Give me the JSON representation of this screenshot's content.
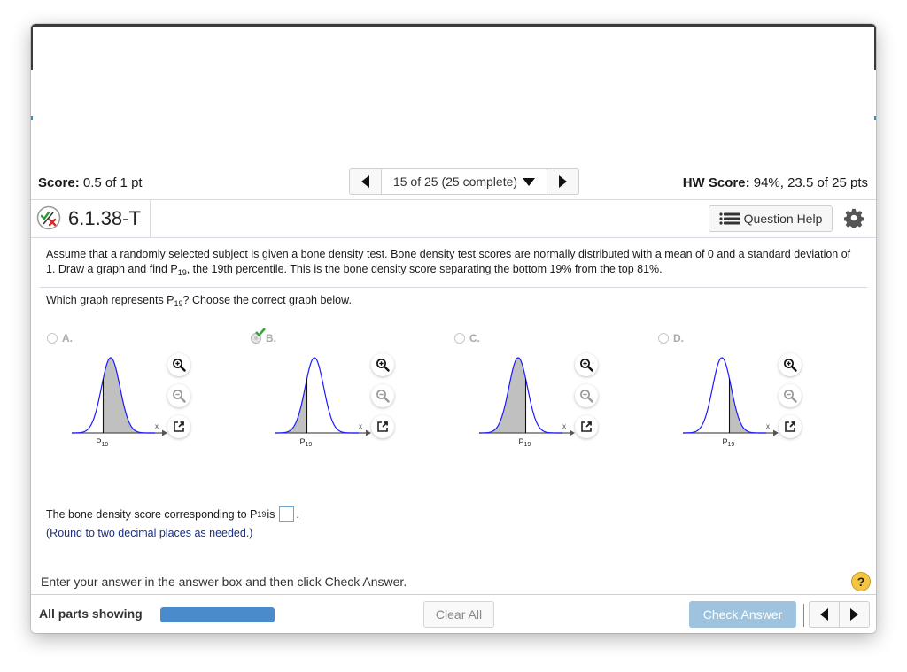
{
  "header": {
    "score_label": "Score:",
    "score_value": "0.5 of 1 pt",
    "hw_score_label": "HW Score:",
    "hw_score_value": "94%, 23.5 of 25 pts",
    "question_nav": {
      "label": "15 of 25 (25 complete)",
      "current": 15,
      "total": 25,
      "complete": 25
    }
  },
  "question": {
    "status_icon": "partial-credit-icon",
    "id": "6.1.38-T",
    "help_label": "Question Help",
    "prompt_part1": "Assume that a randomly selected subject is given a bone density test. Bone density test scores are normally distributed with a mean of 0 and a standard deviation of 1. Draw a graph and find P",
    "prompt_sub": "19",
    "prompt_part2": ", the 19th percentile. This is the bone density score separating the bottom 19% from the top 81%.",
    "which_part1": "Which graph represents P",
    "which_sub": "19",
    "which_part2": "? Choose the correct graph below.",
    "options": [
      {
        "letter": "A.",
        "shading": "right-of-line",
        "line_position": "left",
        "selected": false,
        "correct": false
      },
      {
        "letter": "B.",
        "shading": "left-of-line",
        "line_position": "left",
        "selected": true,
        "correct": true
      },
      {
        "letter": "C.",
        "shading": "left-of-line",
        "line_position": "right",
        "selected": false,
        "correct": false
      },
      {
        "letter": "D.",
        "shading": "right-of-line",
        "line_position": "right",
        "selected": false,
        "correct": false
      }
    ],
    "graph_labels": {
      "axis": "x",
      "marker": "P",
      "marker_sub": "19"
    },
    "answer_part1": "The bone density score corresponding to P",
    "answer_sub": "19",
    "answer_part2": " is",
    "answer_value": "",
    "answer_suffix": ".",
    "round_note": "(Round to two decimal places as needed.)"
  },
  "footer": {
    "hint": "Enter your answer in the answer box and then click Check Answer.",
    "help_symbol": "?",
    "parts_label": "All parts showing",
    "progress_fraction": 1.0,
    "clear_label": "Clear All",
    "check_label": "Check Answer"
  },
  "colors": {
    "curve": "#1a1aff",
    "shade": "#c0c0c0",
    "progress": "#4a8ccb",
    "check_button": "#9dc3de",
    "correct_check": "#3aa53a"
  }
}
